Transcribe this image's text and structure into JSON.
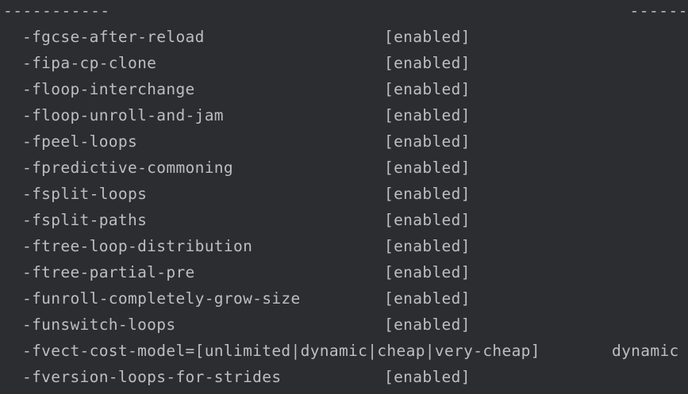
{
  "terminal": {
    "separator_left": "-----------",
    "separator_right": "------",
    "rows": [
      {
        "flag": "-fgcse-after-reload",
        "value": "[enabled]"
      },
      {
        "flag": "-fipa-cp-clone",
        "value": "[enabled]"
      },
      {
        "flag": "-floop-interchange",
        "value": "[enabled]"
      },
      {
        "flag": "-floop-unroll-and-jam",
        "value": "[enabled]"
      },
      {
        "flag": "-fpeel-loops",
        "value": "[enabled]"
      },
      {
        "flag": "-fpredictive-commoning",
        "value": "[enabled]"
      },
      {
        "flag": "-fsplit-loops",
        "value": "[enabled]"
      },
      {
        "flag": "-fsplit-paths",
        "value": "[enabled]"
      },
      {
        "flag": "-ftree-loop-distribution",
        "value": "[enabled]"
      },
      {
        "flag": "-ftree-partial-pre",
        "value": "[enabled]"
      },
      {
        "flag": "-funroll-completely-grow-size",
        "value": "[enabled]"
      },
      {
        "flag": "-funswitch-loops",
        "value": "[enabled]"
      },
      {
        "flag": "-fvect-cost-model=[unlimited|dynamic|cheap|very-cheap]",
        "value": "dynamic"
      },
      {
        "flag": "-fversion-loops-for-strides",
        "value": "[enabled]"
      }
    ]
  },
  "colors": {
    "background": "#2b2d30",
    "text": "#bcbec4"
  }
}
